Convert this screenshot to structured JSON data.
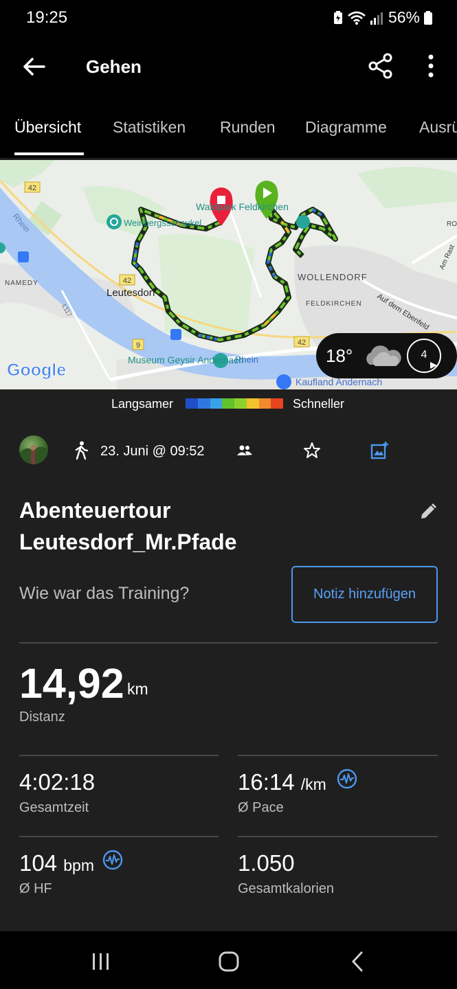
{
  "status_bar": {
    "time": "19:25",
    "battery": "56%"
  },
  "app_bar": {
    "title": "Gehen"
  },
  "tabs": [
    {
      "label": "Übersicht",
      "active": true
    },
    {
      "label": "Statistiken",
      "active": false
    },
    {
      "label": "Runden",
      "active": false
    },
    {
      "label": "Diagramme",
      "active": false
    },
    {
      "label": "Ausrü",
      "active": false
    }
  ],
  "map": {
    "labels": {
      "waldpark": "Waldpark Feldkirchen",
      "weinberg": "Weinbergsschaukel",
      "wollendorf": "WOLLENDORF",
      "feldkirchen": "FELDKIRCHEN",
      "namedy": "NAMEDY",
      "leutesdorf": "Leutesdorf",
      "rhein_top": "Rhein",
      "rhein_bottom": "Rhein",
      "ebenfeld": "Auf dem Ebenfeld",
      "am_rast": "Am Rast",
      "museum": "Museum Geysir Andernach",
      "kaufland": "Kaufland Andernach",
      "road_42a": "42",
      "road_42b": "42",
      "road_42c": "42",
      "road_9": "9",
      "road_l117": "L117",
      "ro": "RO",
      "google": "Google"
    },
    "weather": {
      "temp": "18°",
      "wind": "4"
    }
  },
  "legend": {
    "slow": "Langsamer",
    "fast": "Schneller",
    "colors": [
      "#1f4fc8",
      "#2f78e0",
      "#3aa0e8",
      "#62c12c",
      "#8ed12f",
      "#f2c12d",
      "#f08a2b",
      "#e5451f"
    ]
  },
  "activity": {
    "date": "23. Juni @ 09:52",
    "title_line1": "Abenteuertour",
    "title_line2": "Leutesdorf_Mr.Pfade",
    "question": "Wie war das Training?",
    "note_button": "Notiz hinzufügen"
  },
  "stats": {
    "distance": {
      "value": "14,92",
      "unit": "km",
      "label": "Distanz"
    },
    "total_time": {
      "value": "4:02:18",
      "label": "Gesamtzeit"
    },
    "pace": {
      "value": "16:14",
      "unit": "/km",
      "label": "Ø Pace"
    },
    "hr": {
      "value": "104",
      "unit": "bpm",
      "label": "Ø HF"
    },
    "calories": {
      "value": "1.050",
      "label": "Gesamtkalorien"
    }
  }
}
